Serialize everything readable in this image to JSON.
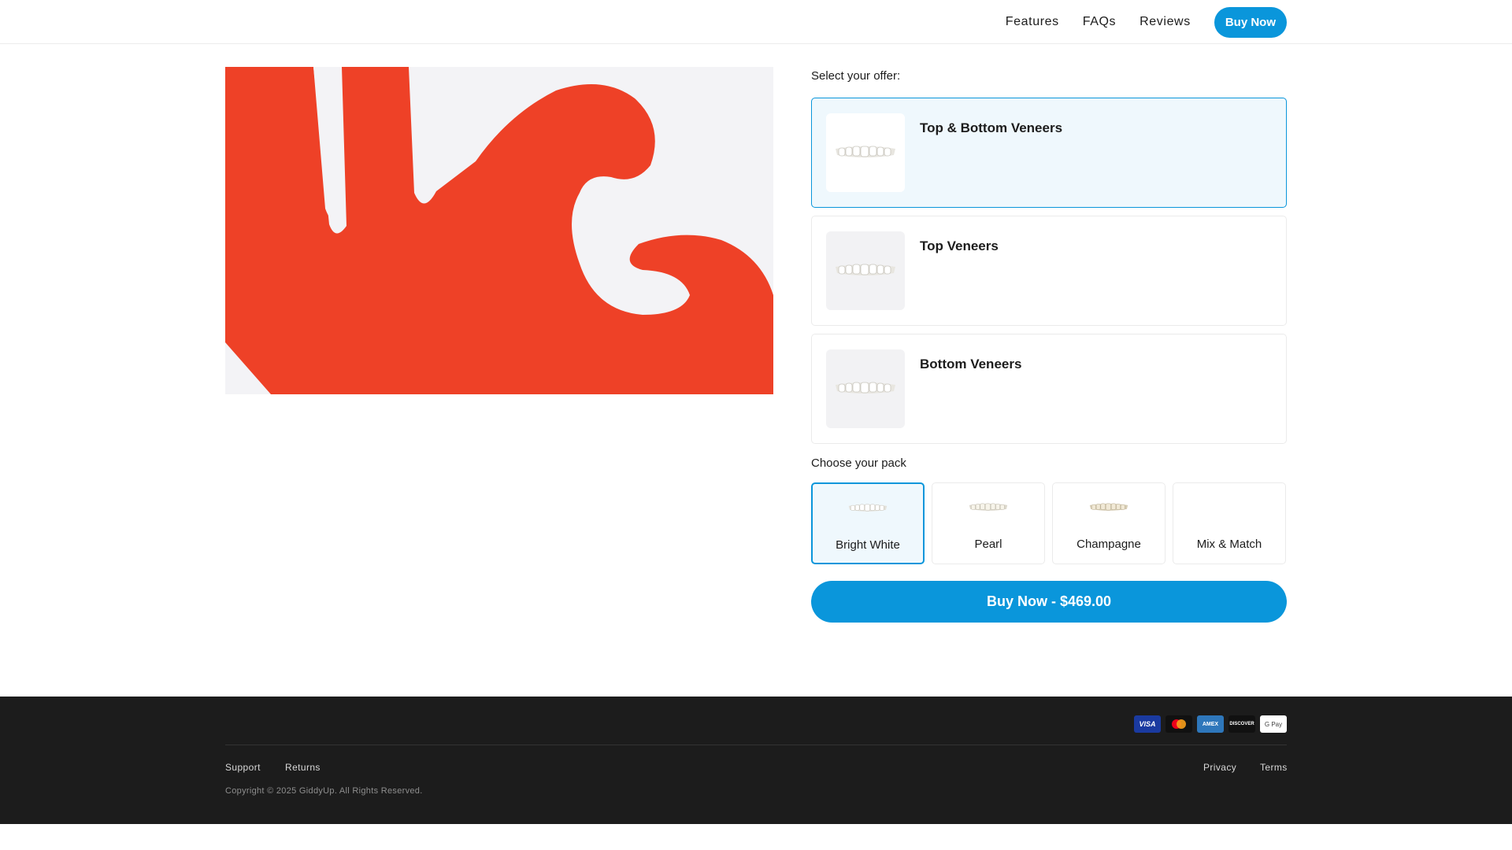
{
  "nav": {
    "links": [
      "Features",
      "FAQs",
      "Reviews"
    ],
    "buy_label": "Buy Now"
  },
  "hero": {
    "logo_icon": "giddyup-hand-logo",
    "colors": {
      "logo_red": "#ee4127",
      "background": "#f3f3f6"
    }
  },
  "offer": {
    "label": "Select your offer:",
    "options": [
      {
        "title": "Top & Bottom Veneers",
        "selected": true
      },
      {
        "title": "Top Veneers",
        "selected": false
      },
      {
        "title": "Bottom Veneers",
        "selected": false
      }
    ]
  },
  "pack": {
    "label": "Choose your pack",
    "options": [
      {
        "name": "Bright White",
        "selected": true,
        "has_image": true
      },
      {
        "name": "Pearl",
        "selected": false,
        "has_image": true
      },
      {
        "name": "Champagne",
        "selected": false,
        "has_image": true
      },
      {
        "name": "Mix & Match",
        "selected": false,
        "has_image": false
      }
    ]
  },
  "cta": {
    "label": "Buy Now - $469.00"
  },
  "footer": {
    "payment_icons": [
      {
        "icon": "visa-icon",
        "text": "VISA"
      },
      {
        "icon": "mastercard-icon",
        "text": ""
      },
      {
        "icon": "amex-icon",
        "text": "AMEX"
      },
      {
        "icon": "discover-icon",
        "text": "DISCOVER"
      },
      {
        "icon": "google-pay-icon",
        "text": "G Pay"
      }
    ],
    "links_left": [
      "Support",
      "Returns"
    ],
    "links_right": [
      "Privacy",
      "Terms"
    ],
    "copyright": "Copyright © 2025 GiddyUp. All Rights Reserved."
  },
  "colors": {
    "accent": "#0a96db",
    "selected_bg": "#eff8fd",
    "footer_bg": "#1c1c1c"
  }
}
